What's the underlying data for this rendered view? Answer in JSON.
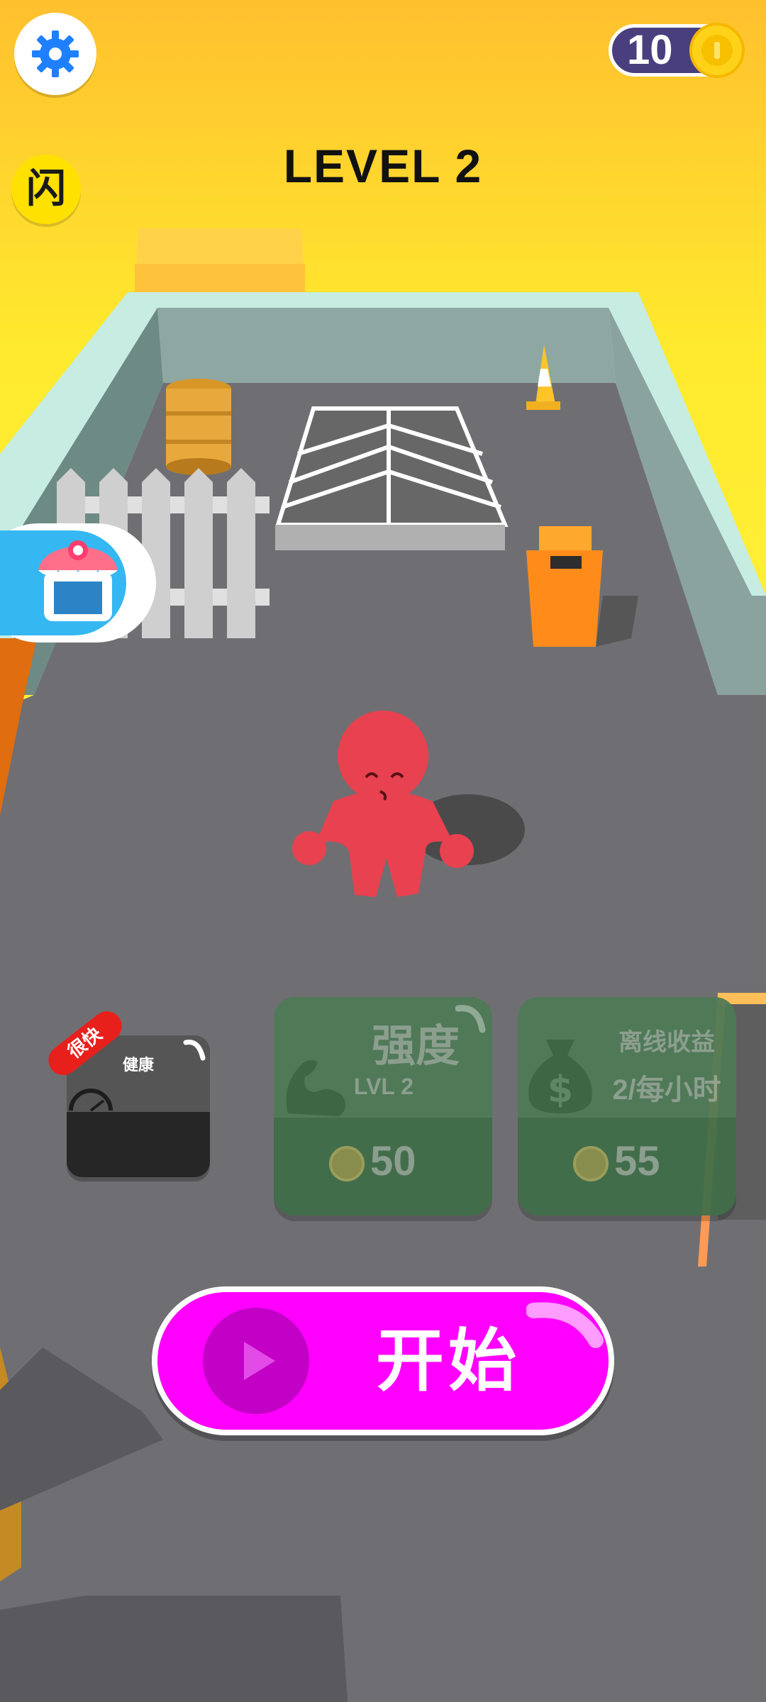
{
  "hud": {
    "coins": "10",
    "level_title": "LEVEL 2",
    "flash_label": "闪"
  },
  "upgrades": {
    "health": {
      "label": "健康",
      "badge": "很快"
    },
    "strength": {
      "title": "强度",
      "level": "LVL 2",
      "price": "50"
    },
    "offline": {
      "title": "离线收益",
      "rate": "2/每小时",
      "price": "55"
    }
  },
  "start_button": {
    "label": "开始"
  },
  "colors": {
    "sky": "#ffe42a",
    "start": "#ff00ff",
    "coin_pill": "#4a3f7e",
    "character": "#e8414f"
  },
  "icons": [
    "gear-icon",
    "flash-icon",
    "shop-icon",
    "coin-icon",
    "bicep-icon",
    "money-bag-icon",
    "play-icon"
  ]
}
